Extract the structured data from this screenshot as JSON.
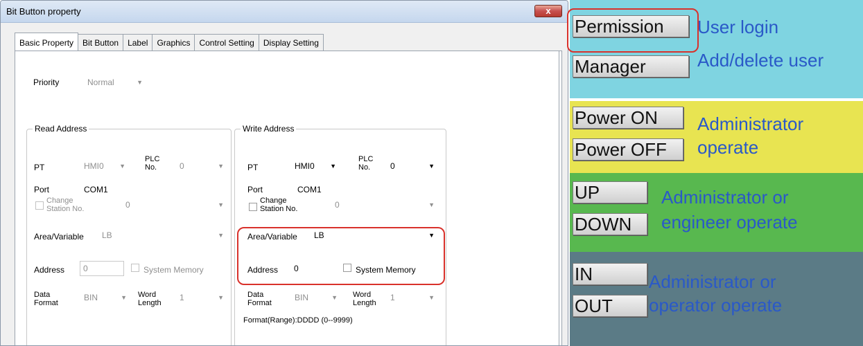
{
  "dialog": {
    "title": "Bit Button property",
    "close_label": "x",
    "tabs": [
      "Basic Property",
      "Bit Button",
      "Label",
      "Graphics",
      "Control Setting",
      "Display Setting"
    ],
    "priority": {
      "label": "Priority",
      "value": "Normal"
    },
    "read_address": {
      "title": "Read Address",
      "pt_label": "PT",
      "pt_value": "HMI0",
      "plc_label_1": "PLC",
      "plc_label_2": "No.",
      "plc_value": "0",
      "port_label": "Port",
      "port_value": "COM1",
      "change_station_1": "Change",
      "change_station_2": "Station No.",
      "change_station_value": "0",
      "area_label": "Area/Variable",
      "area_value": "LB",
      "address_label": "Address",
      "address_value": "0",
      "system_memory": "System Memory",
      "data_format_1": "Data",
      "data_format_2": "Format",
      "data_format_value": "BIN",
      "word_length_1": "Word",
      "word_length_2": "Length",
      "word_length_value": "1"
    },
    "write_address": {
      "title": "Write Address",
      "pt_label": "PT",
      "pt_value": "HMI0",
      "plc_label_1": "PLC",
      "plc_label_2": "No.",
      "plc_value": "0",
      "port_label": "Port",
      "port_value": "COM1",
      "change_station_1": "Change",
      "change_station_2": "Station No.",
      "change_station_value": "0",
      "area_label": "Area/Variable",
      "area_value": "LB",
      "address_label": "Address",
      "address_value": "0",
      "system_memory": "System Memory",
      "data_format_1": "Data",
      "data_format_2": "Format",
      "data_format_value": "BIN",
      "word_length_1": "Word",
      "word_length_2": "Length",
      "word_length_value": "1",
      "format_range": "Format(Range):DDDD (0--9999)"
    }
  },
  "panel": {
    "colors": {
      "cyan": "#7fd4e1",
      "yellow": "#e8e451",
      "green": "#58b84f",
      "slate": "#5b7b86",
      "text_blue": "#2a59c8",
      "highlight": "#d9312b"
    },
    "permission": {
      "button": "Permission",
      "note": "User login"
    },
    "manager": {
      "button": "Manager",
      "note": "Add/delete user"
    },
    "power_on": {
      "button": "Power ON"
    },
    "power_off": {
      "button": "Power OFF"
    },
    "admin_note_1": "Administrator",
    "admin_note_2": "operate",
    "up": {
      "button": "UP"
    },
    "down": {
      "button": "DOWN"
    },
    "eng_note_1": "Administrator or",
    "eng_note_2": "engineer operate",
    "in": {
      "button": "IN"
    },
    "out": {
      "button": "OUT"
    },
    "op_note_1": "Administrator or",
    "op_note_2": "operator operate"
  }
}
